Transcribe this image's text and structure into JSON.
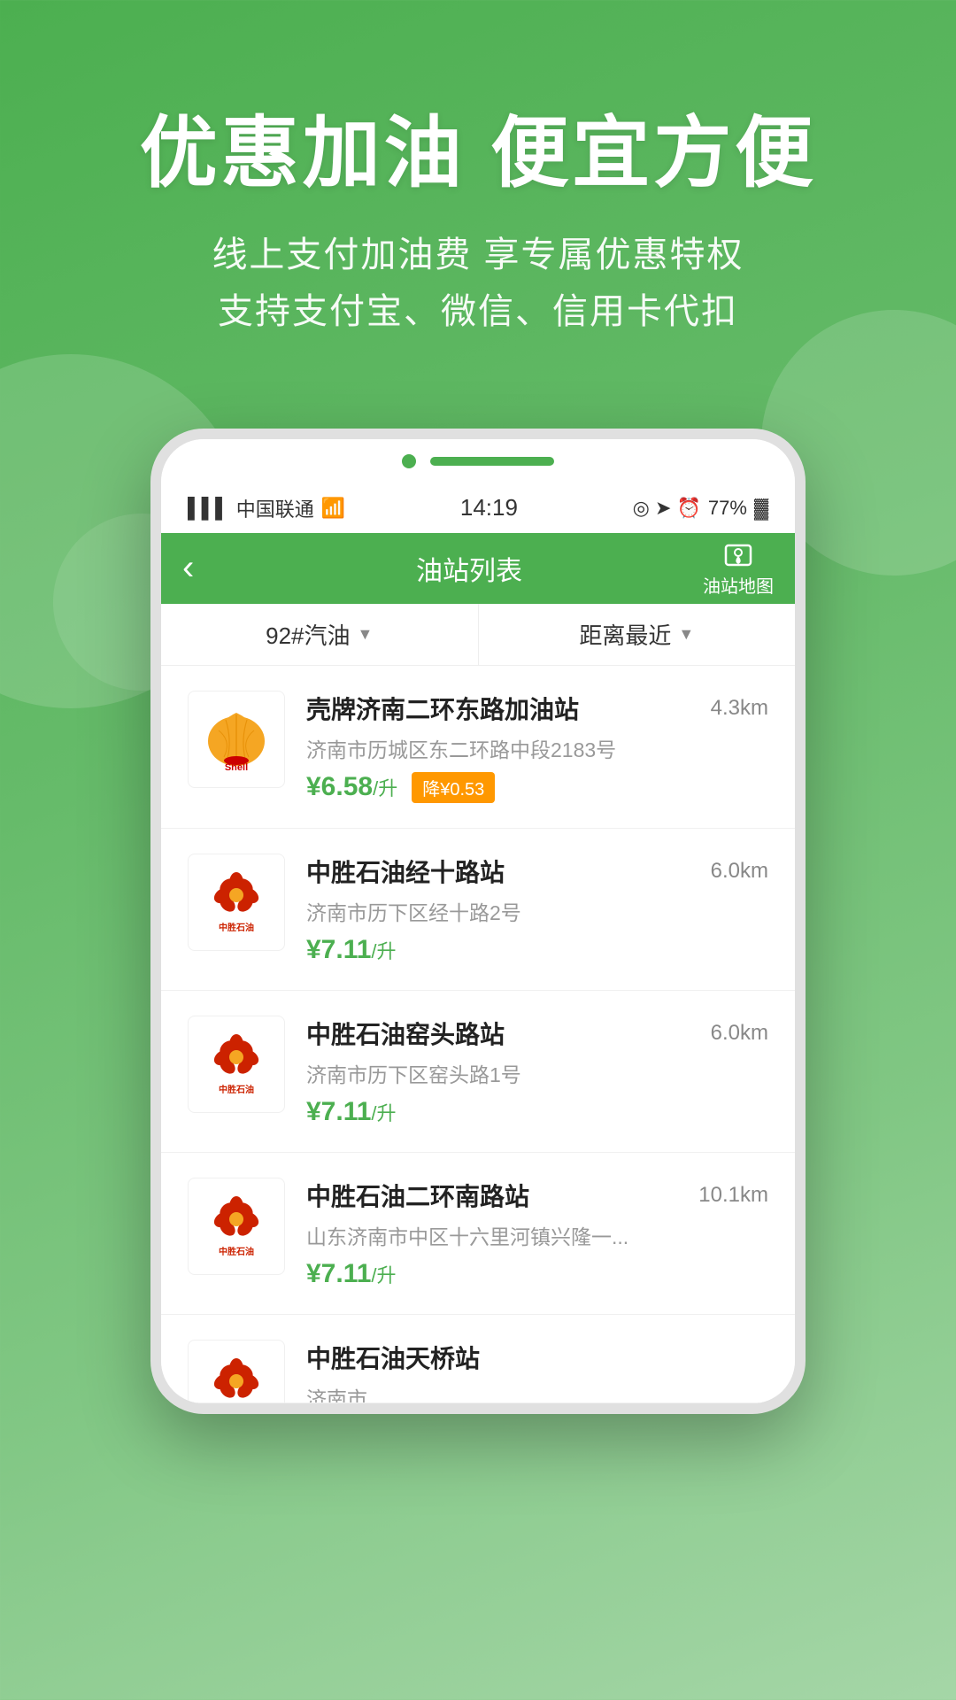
{
  "hero": {
    "title": "优惠加油 便宜方便",
    "subtitle_line1": "线上支付加油费 享专属优惠特权",
    "subtitle_line2": "支持支付宝、微信、信用卡代扣"
  },
  "status_bar": {
    "carrier": "中国联通",
    "time": "14:19",
    "battery": "77%"
  },
  "nav": {
    "back_icon": "‹",
    "title": "油站列表",
    "map_label": "油站地图"
  },
  "filter": {
    "fuel_type": "92#汽油",
    "sort": "距离最近"
  },
  "stations": [
    {
      "id": 1,
      "name": "壳牌济南二环东路加油站",
      "address": "济南市历城区东二环路中段2183号",
      "distance": "4.3km",
      "price": "¥6.58",
      "unit": "/升",
      "discount": "降¥0.53",
      "brand": "Shell"
    },
    {
      "id": 2,
      "name": "中胜石油经十路站",
      "address": "济南市历下区经十路2号",
      "distance": "6.0km",
      "price": "¥7.11",
      "unit": "/升",
      "discount": "",
      "brand": "中胜石油"
    },
    {
      "id": 3,
      "name": "中胜石油窑头路站",
      "address": "济南市历下区窑头路1号",
      "distance": "6.0km",
      "price": "¥7.11",
      "unit": "/升",
      "discount": "",
      "brand": "中胜石油"
    },
    {
      "id": 4,
      "name": "中胜石油二环南路站",
      "address": "山东济南市中区十六里河镇兴隆一...",
      "distance": "10.1km",
      "price": "¥7.11",
      "unit": "/升",
      "discount": "",
      "brand": "中胜石油"
    },
    {
      "id": 5,
      "name": "中胜石油天桥站",
      "address": "济南市...",
      "distance": "",
      "price": "",
      "unit": "",
      "discount": "",
      "brand": "中胜石油"
    }
  ]
}
